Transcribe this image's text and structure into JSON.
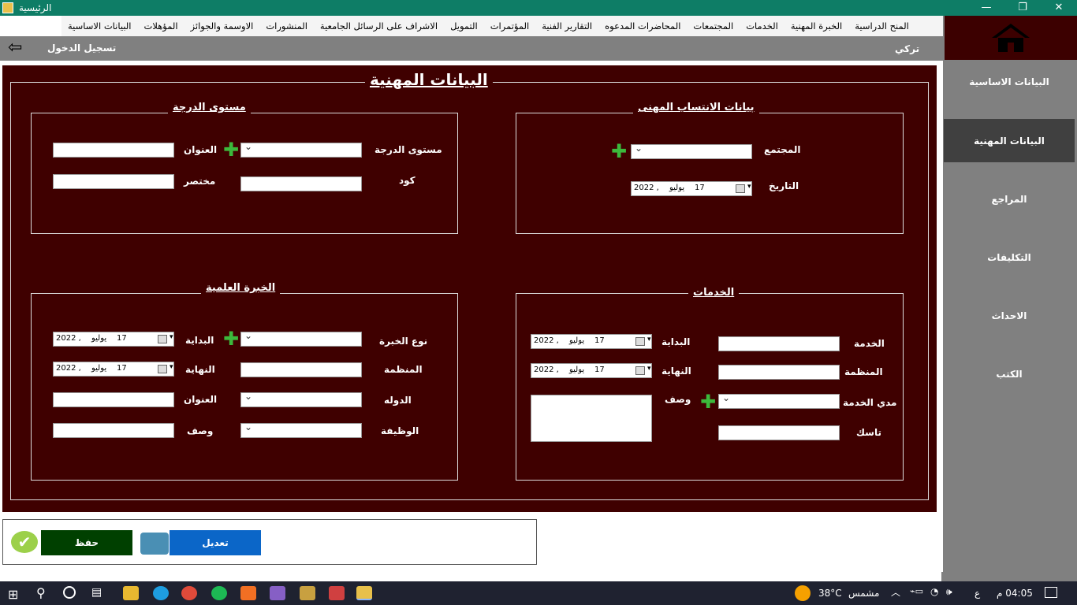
{
  "window": {
    "title": "الرئيسية",
    "min": "—",
    "max": "❐",
    "close": "✕"
  },
  "menu": [
    "البيانات الاساسية",
    "المؤهلات",
    "الاوسمة والجوائز",
    "المنشورات",
    "الاشراف على الرسائل الجامعية",
    "التمويل",
    "المؤتمرات",
    "التقارير الفنية",
    "المحاضرات المدعوه",
    "المجتمعات",
    "الخدمات",
    "الخبرة المهنية",
    "المنح الدراسية"
  ],
  "header": {
    "user": "تركي",
    "login": "تسجيل الدخول"
  },
  "sidebar": [
    "البيانات الاساسية",
    "البيانات المهنية",
    "المراجع",
    "التكليفات",
    "الاحداث",
    "الكتب"
  ],
  "page_title": "البيانات المهنية",
  "affiliation": {
    "legend": "بيانات الانتساب المهنى",
    "community": "المجتمع",
    "date": "التاريخ",
    "date_value": {
      "day": "17",
      "month": "يوليو",
      "year": "2022 ,"
    }
  },
  "degree": {
    "legend": "مستوى الدرجة",
    "level": "مستوى الدرجة",
    "title": "العنوان",
    "code": "كود",
    "short": "مختصر"
  },
  "services": {
    "legend": "الخدمات",
    "service": "الخدمة",
    "org": "المنظمة",
    "duration": "مدي الخدمة",
    "task": "تاسك",
    "start": "البداية",
    "end": "النهاية",
    "desc": "وصف",
    "start_value": {
      "day": "17",
      "month": "يوليو",
      "year": "2022 ,"
    },
    "end_value": {
      "day": "17",
      "month": "يوليو",
      "year": "2022 ,"
    }
  },
  "experience": {
    "legend": "الخبرة العلمية",
    "type": "نوع الخبرة",
    "org": "المنظمة",
    "country": "الدوله",
    "job": "الوظيفة",
    "start": "البداية",
    "end": "النهاية",
    "title": "العنوان",
    "desc": "وصف",
    "start_value": {
      "day": "17",
      "month": "يوليو",
      "year": "2022 ,"
    },
    "end_value": {
      "day": "17",
      "month": "يوليو",
      "year": "2022 ,"
    }
  },
  "actions": {
    "save": "حفظ",
    "edit": "تعديل"
  },
  "taskbar": {
    "weather": "38°C",
    "weather_desc": "مشمس",
    "lang": "ع",
    "time": "04:05 م"
  }
}
